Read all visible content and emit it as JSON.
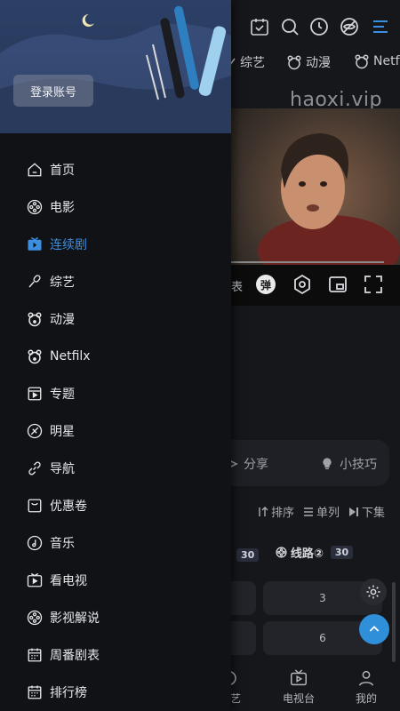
{
  "drawer": {
    "login_label": "登录账号",
    "menu": [
      {
        "label": "首页",
        "icon": "home-icon",
        "active": false
      },
      {
        "label": "电影",
        "icon": "film-reel-icon",
        "active": false
      },
      {
        "label": "连续剧",
        "icon": "tv-play-icon",
        "active": true
      },
      {
        "label": "综艺",
        "icon": "microphone-icon",
        "active": false
      },
      {
        "label": "动漫",
        "icon": "bear-icon",
        "active": false
      },
      {
        "label": "Netfilx",
        "icon": "bear-icon",
        "active": false
      },
      {
        "label": "专题",
        "icon": "topic-icon",
        "active": false
      },
      {
        "label": "明星",
        "icon": "star-icon",
        "active": false
      },
      {
        "label": "导航",
        "icon": "link-icon",
        "active": false
      },
      {
        "label": "优惠卷",
        "icon": "coupon-icon",
        "active": false
      },
      {
        "label": "音乐",
        "icon": "music-icon",
        "active": false
      },
      {
        "label": "看电视",
        "icon": "tv-icon",
        "active": false
      },
      {
        "label": "影视解说",
        "icon": "film-reel-icon",
        "active": false
      },
      {
        "label": "周番剧表",
        "icon": "calendar-icon",
        "active": false
      },
      {
        "label": "排行榜",
        "icon": "calendar-icon",
        "active": false
      }
    ]
  },
  "background": {
    "categories": [
      "综艺",
      "动漫",
      "Netf"
    ],
    "watermark": "haoxi.vip",
    "danmaku_badge": "弹",
    "partial_label": "表",
    "share_label": "分享",
    "tips_label": "小技巧",
    "sort": [
      "排序",
      "单列",
      "下集"
    ],
    "route_count_1": "30",
    "route_label_2": "线路②",
    "route_count_2": "30",
    "episodes": [
      "3",
      "6"
    ],
    "bottom_nav": [
      "艺",
      "电视台",
      "我的"
    ]
  },
  "colors": {
    "accent": "#3b8fe0",
    "fab": "#2f8fd8",
    "drawer_bg": "#111216"
  }
}
